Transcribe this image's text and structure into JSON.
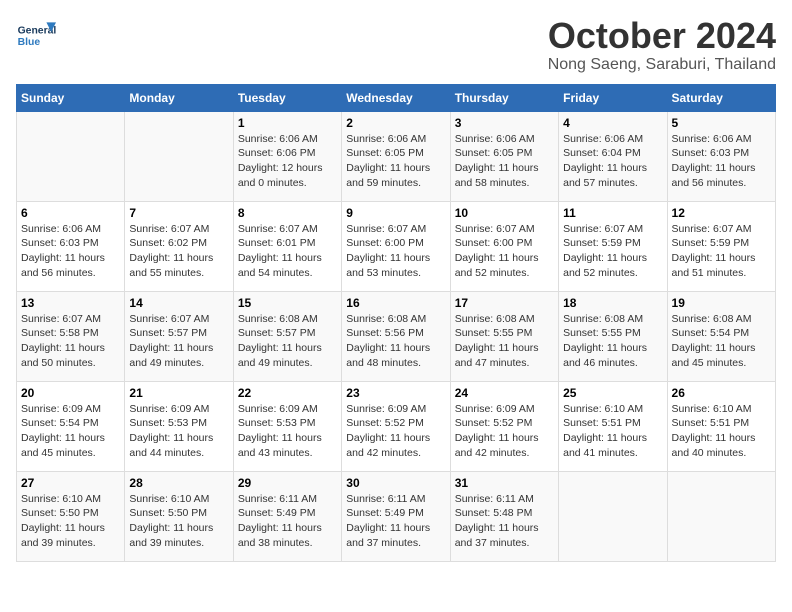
{
  "header": {
    "logo_general": "General",
    "logo_blue": "Blue",
    "month_title": "October 2024",
    "location": "Nong Saeng, Saraburi, Thailand"
  },
  "days_of_week": [
    "Sunday",
    "Monday",
    "Tuesday",
    "Wednesday",
    "Thursday",
    "Friday",
    "Saturday"
  ],
  "weeks": [
    [
      {
        "day": "",
        "info": ""
      },
      {
        "day": "",
        "info": ""
      },
      {
        "day": "1",
        "info": "Sunrise: 6:06 AM\nSunset: 6:06 PM\nDaylight: 12 hours\nand 0 minutes."
      },
      {
        "day": "2",
        "info": "Sunrise: 6:06 AM\nSunset: 6:05 PM\nDaylight: 11 hours\nand 59 minutes."
      },
      {
        "day": "3",
        "info": "Sunrise: 6:06 AM\nSunset: 6:05 PM\nDaylight: 11 hours\nand 58 minutes."
      },
      {
        "day": "4",
        "info": "Sunrise: 6:06 AM\nSunset: 6:04 PM\nDaylight: 11 hours\nand 57 minutes."
      },
      {
        "day": "5",
        "info": "Sunrise: 6:06 AM\nSunset: 6:03 PM\nDaylight: 11 hours\nand 56 minutes."
      }
    ],
    [
      {
        "day": "6",
        "info": "Sunrise: 6:06 AM\nSunset: 6:03 PM\nDaylight: 11 hours\nand 56 minutes."
      },
      {
        "day": "7",
        "info": "Sunrise: 6:07 AM\nSunset: 6:02 PM\nDaylight: 11 hours\nand 55 minutes."
      },
      {
        "day": "8",
        "info": "Sunrise: 6:07 AM\nSunset: 6:01 PM\nDaylight: 11 hours\nand 54 minutes."
      },
      {
        "day": "9",
        "info": "Sunrise: 6:07 AM\nSunset: 6:00 PM\nDaylight: 11 hours\nand 53 minutes."
      },
      {
        "day": "10",
        "info": "Sunrise: 6:07 AM\nSunset: 6:00 PM\nDaylight: 11 hours\nand 52 minutes."
      },
      {
        "day": "11",
        "info": "Sunrise: 6:07 AM\nSunset: 5:59 PM\nDaylight: 11 hours\nand 52 minutes."
      },
      {
        "day": "12",
        "info": "Sunrise: 6:07 AM\nSunset: 5:59 PM\nDaylight: 11 hours\nand 51 minutes."
      }
    ],
    [
      {
        "day": "13",
        "info": "Sunrise: 6:07 AM\nSunset: 5:58 PM\nDaylight: 11 hours\nand 50 minutes."
      },
      {
        "day": "14",
        "info": "Sunrise: 6:07 AM\nSunset: 5:57 PM\nDaylight: 11 hours\nand 49 minutes."
      },
      {
        "day": "15",
        "info": "Sunrise: 6:08 AM\nSunset: 5:57 PM\nDaylight: 11 hours\nand 49 minutes."
      },
      {
        "day": "16",
        "info": "Sunrise: 6:08 AM\nSunset: 5:56 PM\nDaylight: 11 hours\nand 48 minutes."
      },
      {
        "day": "17",
        "info": "Sunrise: 6:08 AM\nSunset: 5:55 PM\nDaylight: 11 hours\nand 47 minutes."
      },
      {
        "day": "18",
        "info": "Sunrise: 6:08 AM\nSunset: 5:55 PM\nDaylight: 11 hours\nand 46 minutes."
      },
      {
        "day": "19",
        "info": "Sunrise: 6:08 AM\nSunset: 5:54 PM\nDaylight: 11 hours\nand 45 minutes."
      }
    ],
    [
      {
        "day": "20",
        "info": "Sunrise: 6:09 AM\nSunset: 5:54 PM\nDaylight: 11 hours\nand 45 minutes."
      },
      {
        "day": "21",
        "info": "Sunrise: 6:09 AM\nSunset: 5:53 PM\nDaylight: 11 hours\nand 44 minutes."
      },
      {
        "day": "22",
        "info": "Sunrise: 6:09 AM\nSunset: 5:53 PM\nDaylight: 11 hours\nand 43 minutes."
      },
      {
        "day": "23",
        "info": "Sunrise: 6:09 AM\nSunset: 5:52 PM\nDaylight: 11 hours\nand 42 minutes."
      },
      {
        "day": "24",
        "info": "Sunrise: 6:09 AM\nSunset: 5:52 PM\nDaylight: 11 hours\nand 42 minutes."
      },
      {
        "day": "25",
        "info": "Sunrise: 6:10 AM\nSunset: 5:51 PM\nDaylight: 11 hours\nand 41 minutes."
      },
      {
        "day": "26",
        "info": "Sunrise: 6:10 AM\nSunset: 5:51 PM\nDaylight: 11 hours\nand 40 minutes."
      }
    ],
    [
      {
        "day": "27",
        "info": "Sunrise: 6:10 AM\nSunset: 5:50 PM\nDaylight: 11 hours\nand 39 minutes."
      },
      {
        "day": "28",
        "info": "Sunrise: 6:10 AM\nSunset: 5:50 PM\nDaylight: 11 hours\nand 39 minutes."
      },
      {
        "day": "29",
        "info": "Sunrise: 6:11 AM\nSunset: 5:49 PM\nDaylight: 11 hours\nand 38 minutes."
      },
      {
        "day": "30",
        "info": "Sunrise: 6:11 AM\nSunset: 5:49 PM\nDaylight: 11 hours\nand 37 minutes."
      },
      {
        "day": "31",
        "info": "Sunrise: 6:11 AM\nSunset: 5:48 PM\nDaylight: 11 hours\nand 37 minutes."
      },
      {
        "day": "",
        "info": ""
      },
      {
        "day": "",
        "info": ""
      }
    ]
  ]
}
